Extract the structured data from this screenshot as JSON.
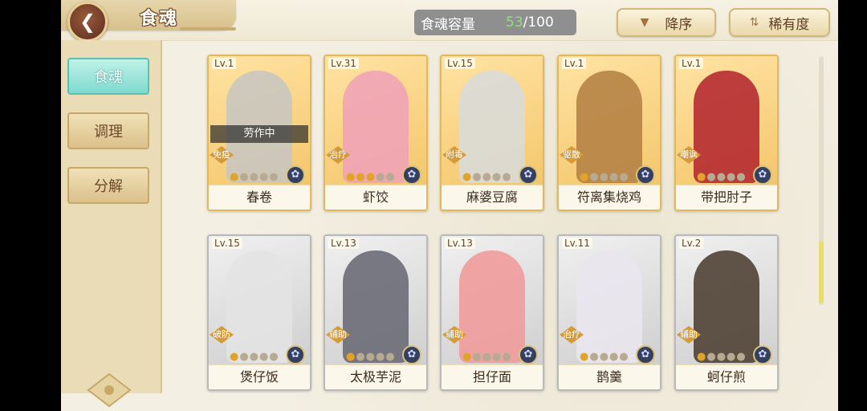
{
  "header": {
    "back_icon": "chevron-left-icon",
    "title": "食魂",
    "capacity_label": "食魂容量",
    "capacity_current": "53",
    "capacity_max": "/100",
    "sort_order_label": "降序",
    "sort_order_icon": "triangle-down-icon",
    "sort_field_label": "稀有度",
    "sort_field_icon": "sort-arrows-icon"
  },
  "sidebar": {
    "items": [
      {
        "label": "食魂",
        "active": true
      },
      {
        "label": "调理",
        "active": false
      },
      {
        "label": "分解",
        "active": false
      }
    ]
  },
  "cards": [
    {
      "level": "Lv.1",
      "name": "春卷",
      "role": "免疫",
      "status": "劳作中",
      "stars": 1,
      "frame": "gold",
      "art_color": "#c9c6c0"
    },
    {
      "level": "Lv.31",
      "name": "虾饺",
      "role": "治疗",
      "status": "",
      "stars": 3,
      "frame": "gold",
      "art_color": "#f0a3b6"
    },
    {
      "level": "Lv.15",
      "name": "麻婆豆腐",
      "role": "附毒",
      "status": "",
      "stars": 1,
      "frame": "gold",
      "art_color": "#d9dad8"
    },
    {
      "level": "Lv.1",
      "name": "符离集烧鸡",
      "role": "驱散",
      "status": "",
      "stars": 1,
      "frame": "gold",
      "art_color": "#b58346"
    },
    {
      "level": "Lv.1",
      "name": "带把肘子",
      "role": "嘲讽",
      "status": "",
      "stars": 1,
      "frame": "gold",
      "art_color": "#b52b32"
    },
    {
      "level": "Lv.15",
      "name": "煲仔饭",
      "role": "破防",
      "status": "",
      "stars": 1,
      "frame": "gray",
      "art_color": "#e3e3e3"
    },
    {
      "level": "Lv.13",
      "name": "太极芋泥",
      "role": "辅助",
      "status": "",
      "stars": 1,
      "frame": "gray",
      "art_color": "#6c6c77"
    },
    {
      "level": "Lv.13",
      "name": "担仔面",
      "role": "辅助",
      "status": "",
      "stars": 1,
      "frame": "gray",
      "art_color": "#ef9b9b"
    },
    {
      "level": "Lv.11",
      "name": "鹊羹",
      "role": "治疗",
      "status": "",
      "stars": 1,
      "frame": "gray",
      "art_color": "#e9e6ee"
    },
    {
      "level": "Lv.2",
      "name": "蚵仔煎",
      "role": "辅助",
      "status": "",
      "stars": 1,
      "frame": "gray",
      "art_color": "#4f4334"
    }
  ],
  "colors": {
    "accent_gold": "#e3b85b",
    "active_tab": "#7fd9cf",
    "capacity_current": "#8ee17a"
  }
}
